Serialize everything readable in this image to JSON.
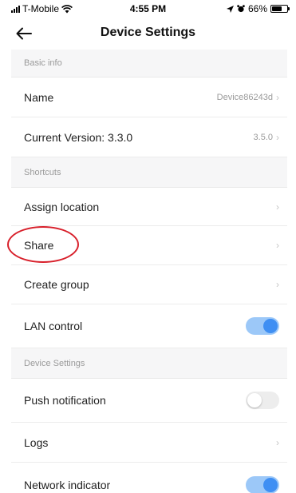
{
  "status_bar": {
    "carrier": "T-Mobile",
    "time": "4:55 PM",
    "battery_percent": "66%",
    "battery_level": 0.66,
    "icons": [
      "signal-icon",
      "wifi-icon",
      "location-arrow-icon",
      "alarm-icon",
      "battery-icon"
    ]
  },
  "nav": {
    "title": "Device Settings",
    "back_icon": "arrow-left-icon"
  },
  "sections": {
    "basic_info": {
      "header": "Basic info",
      "name_label": "Name",
      "name_value": "Device86243d",
      "version_label": "Current Version: 3.3.0",
      "version_value": "3.5.0"
    },
    "shortcuts": {
      "header": "Shortcuts",
      "assign_location": "Assign location",
      "share": "Share",
      "create_group": "Create group",
      "lan_control": "LAN control",
      "lan_control_on": true
    },
    "device_settings": {
      "header": "Device Settings",
      "push_notification": "Push notification",
      "push_notification_on": false,
      "logs": "Logs",
      "network_indicator": "Network indicator",
      "network_indicator_on": true
    }
  },
  "colors": {
    "accent": "#3f8ff3",
    "toggle_track_on": "#9cc8f8",
    "annotation": "#d8202b",
    "section_bg": "#f6f6f7"
  }
}
